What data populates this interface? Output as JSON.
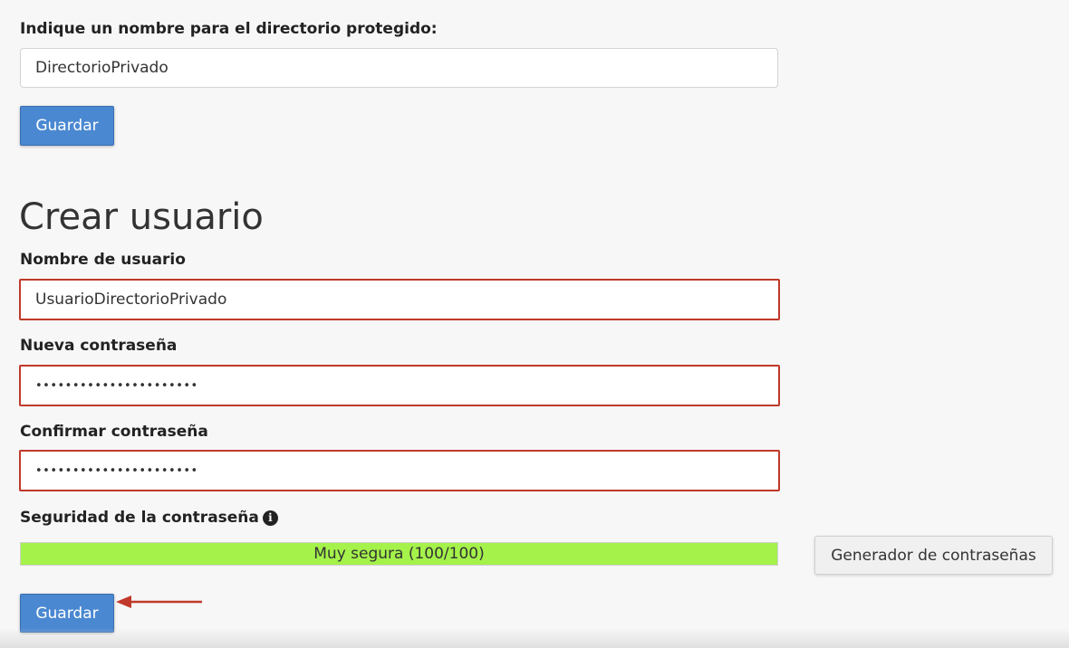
{
  "directory": {
    "label": "Indique un nombre para el directorio protegido:",
    "value": "DirectorioPrivado",
    "save_label": "Guardar"
  },
  "create_user": {
    "heading": "Crear usuario",
    "username_label": "Nombre de usuario",
    "username_value": "UsuarioDirectorioPrivado",
    "new_password_label": "Nueva contraseña",
    "new_password_value": "••••••••••••••••••••••",
    "confirm_password_label": "Confirmar contraseña",
    "confirm_password_value": "••••••••••••••••••••••",
    "strength_label": "Seguridad de la contraseña",
    "strength_text": "Muy segura (100/100)",
    "strength_percent": 100,
    "generator_label": "Generador de contraseñas",
    "save_label": "Guardar"
  },
  "colors": {
    "primary_button": "#4a88d1",
    "highlight_border": "#c0392b",
    "strength_fill": "#a4f24a",
    "annotation_arrow": "#c0392b"
  },
  "icons": {
    "info": "info-icon",
    "arrow": "arrow-left-icon"
  }
}
